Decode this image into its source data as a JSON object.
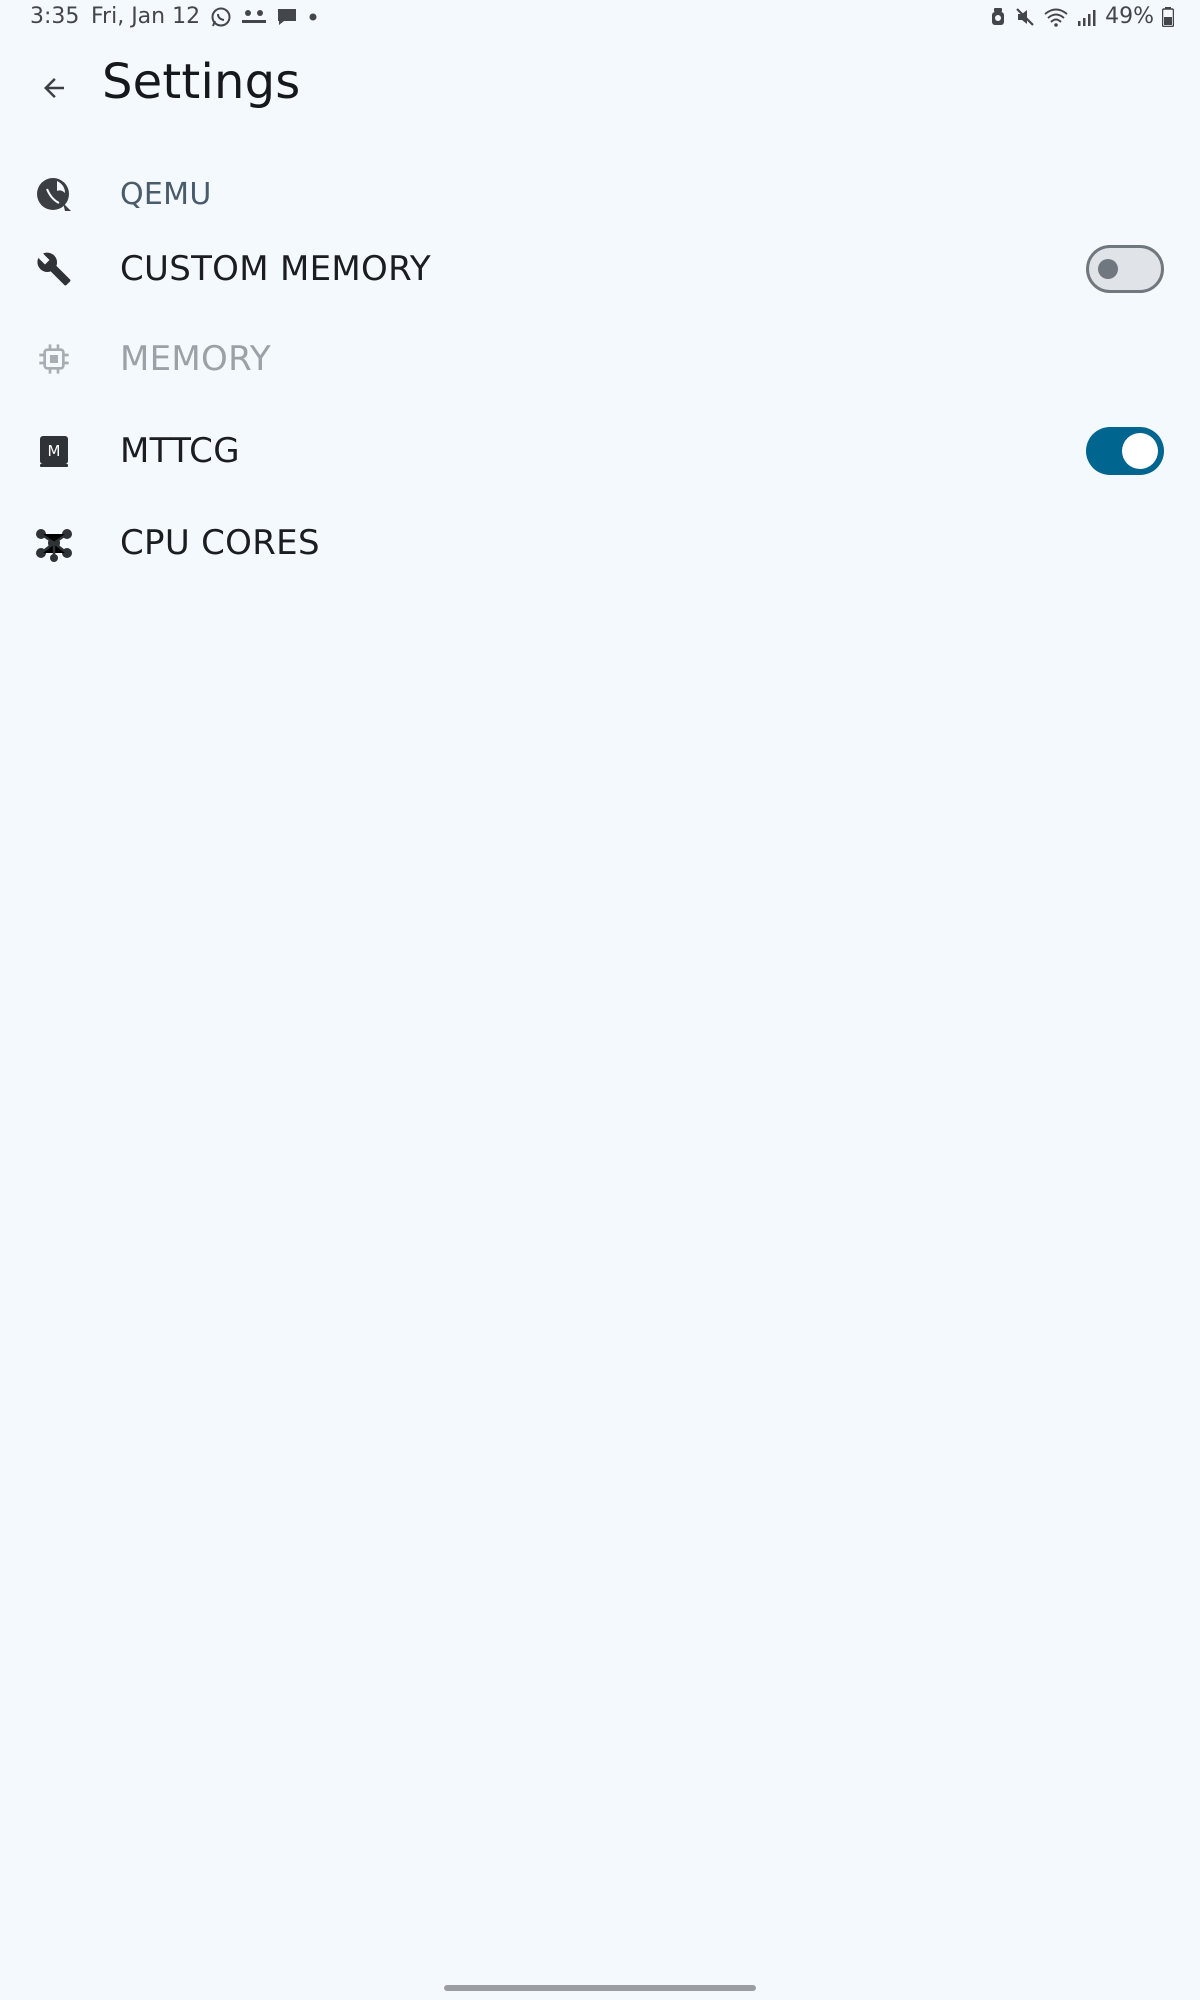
{
  "status_bar": {
    "time": "3:35",
    "date": "Fri, Jan 12",
    "notification_icons": [
      "whatsapp-icon",
      "voicemail-icon",
      "message-icon",
      "more-dot-icon"
    ],
    "system_icons": [
      "alarm-icon",
      "mute-icon",
      "wifi-icon",
      "signal-icon"
    ],
    "battery": "49%"
  },
  "top_bar": {
    "title": "Settings",
    "back_icon": "arrow-back-icon"
  },
  "settings": {
    "section_header": {
      "label": "QEMU",
      "icon": "qemu-logo-icon"
    },
    "items": [
      {
        "label": "CUSTOM MEMORY",
        "icon": "wrench-icon",
        "toggle": "off",
        "enabled": true
      },
      {
        "label": "MEMORY",
        "icon": "chip-icon",
        "enabled": false
      },
      {
        "label": "MTTCG",
        "icon": "m-badge-icon",
        "toggle": "on",
        "enabled": true
      },
      {
        "label": "CPU CORES",
        "icon": "cores-hub-icon",
        "enabled": true
      }
    ]
  },
  "colors": {
    "background": "#f4f9fd",
    "accent": "#00658f",
    "text_primary": "#1b1d20",
    "text_disabled": "#9ba1a7",
    "header_text": "#4a5b6b"
  }
}
